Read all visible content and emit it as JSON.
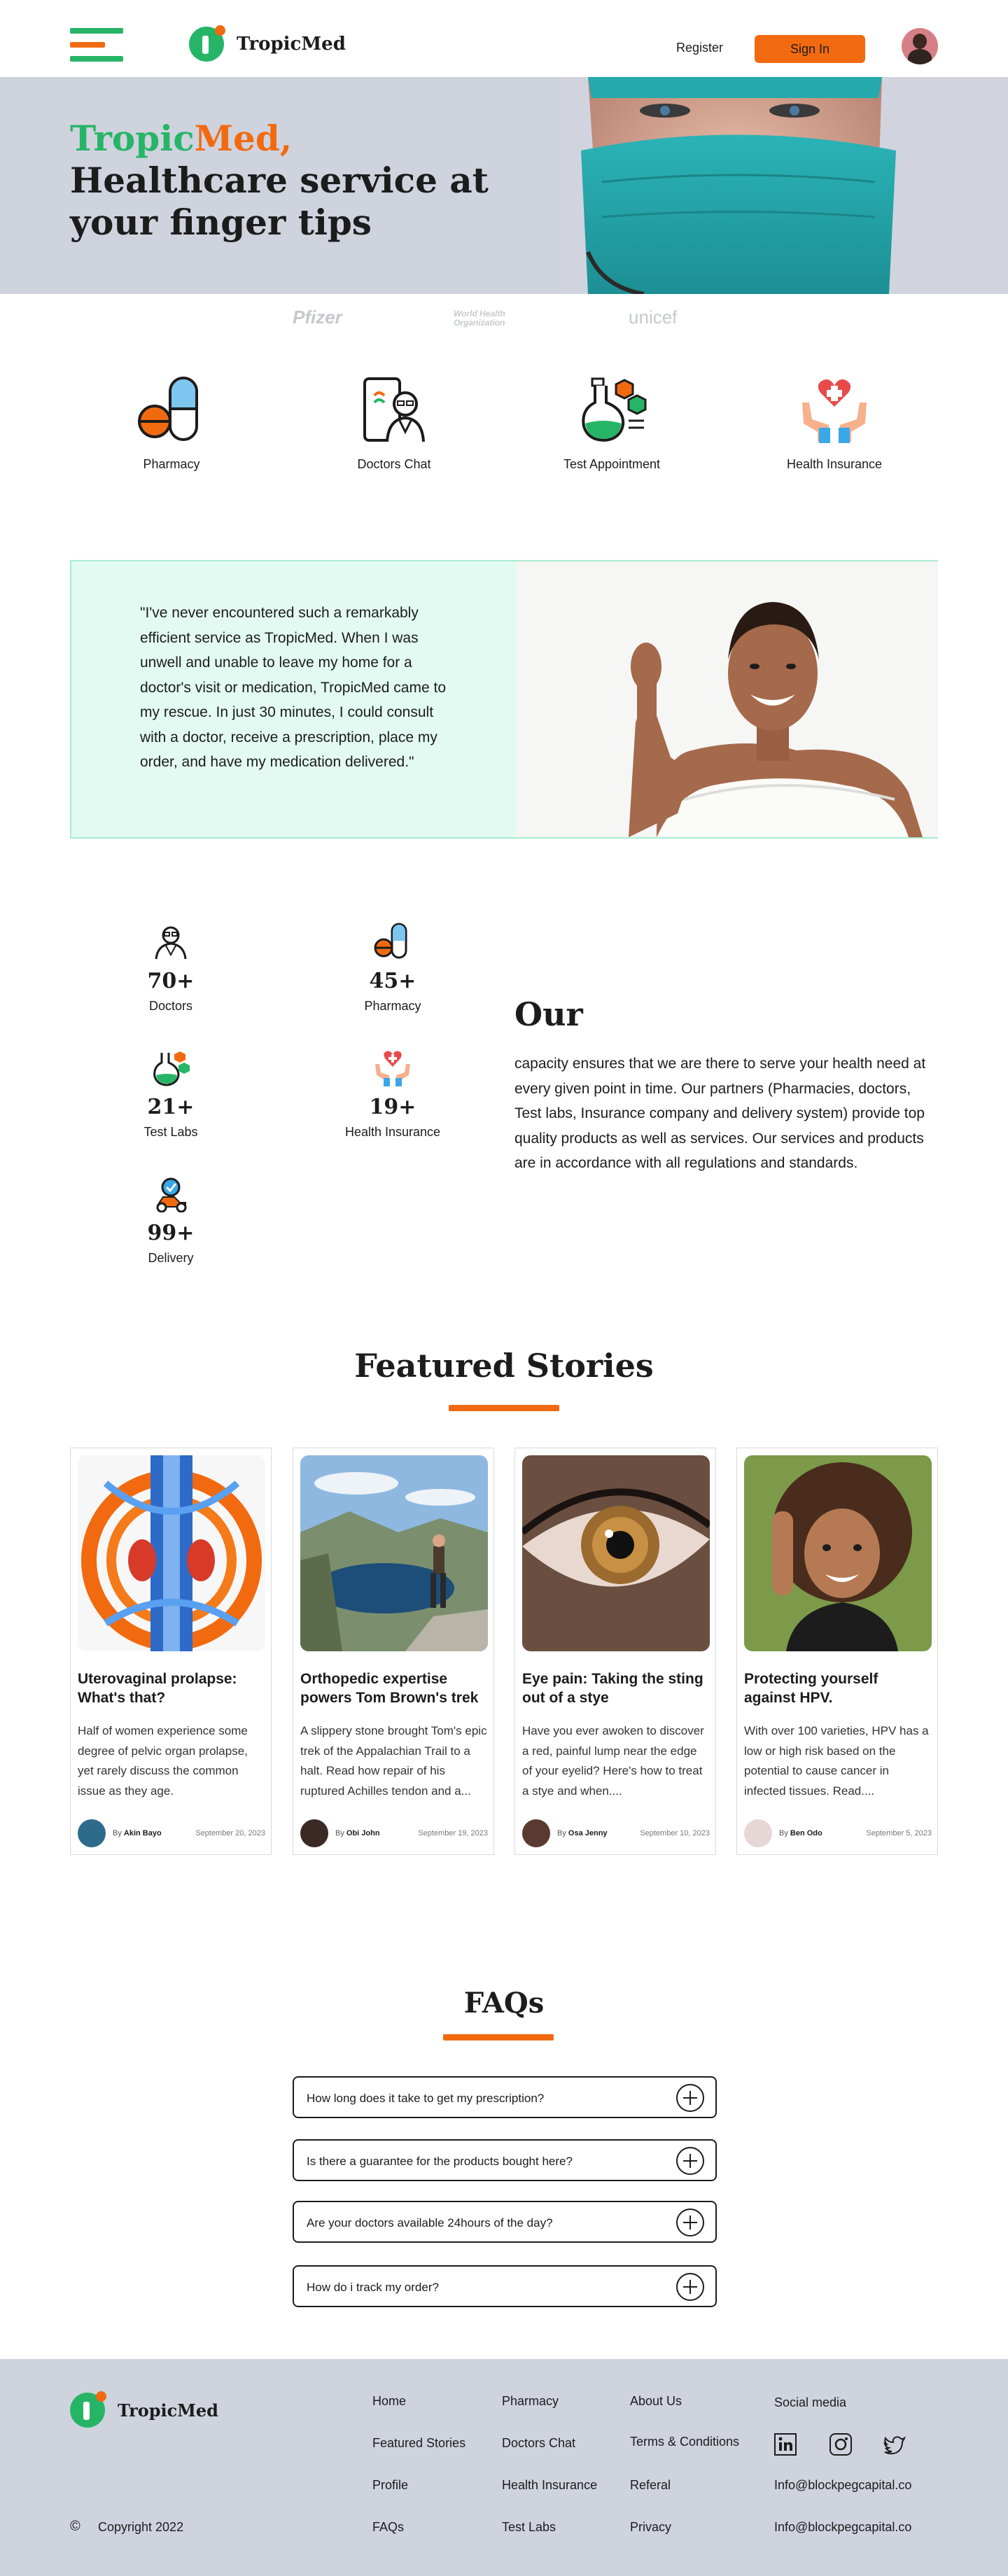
{
  "header": {
    "logo_text": "TropicMed",
    "register_label": "Register",
    "signin_label": "Sign In",
    "menu_colors": [
      "#26b567",
      "#f26a10",
      "#26b567"
    ]
  },
  "hero": {
    "title_part1": "TropicMed,",
    "title_part1a": "Tropic",
    "title_part1b": "Med,",
    "title_part2": " Healthcare service at your finger tips",
    "accent_green": "#26b567",
    "accent_orange": "#f26a10"
  },
  "partners": [
    "Pfizer",
    "World Health Organization",
    "unicef"
  ],
  "services": [
    {
      "label": "Pharmacy",
      "icon": "pill-capsule-icon"
    },
    {
      "label": "Doctors Chat",
      "icon": "doctor-phone-icon"
    },
    {
      "label": "Test Appointment",
      "icon": "lab-flask-icon"
    },
    {
      "label": "Health Insurance",
      "icon": "hands-heart-icon"
    }
  ],
  "testimonial": {
    "quote": "\"I've never encountered such a remarkably efficient service as TropicMed. When I was unwell and unable to leave my home for a doctor's visit or medication, TropicMed came to my rescue. In just 30 minutes, I could consult with a doctor, receive a prescription, place my order, and have my medication delivered.\""
  },
  "stats": [
    {
      "value": "70+",
      "label": "Doctors",
      "icon": "doctor-icon"
    },
    {
      "value": "45+",
      "label": "Pharmacy",
      "icon": "pill-capsule-icon"
    },
    {
      "value": "21+",
      "label": "Test Labs",
      "icon": "lab-flask-icon"
    },
    {
      "value": "19+",
      "label": "Health Insurance",
      "icon": "hands-heart-icon"
    },
    {
      "value": "99+",
      "label": "Delivery",
      "icon": "delivery-icon"
    }
  ],
  "our": {
    "title": "Our",
    "body": "capacity ensures that we are there to serve your health need at every given point in time. Our partners (Pharmacies, doctors, Test labs, Insurance company and delivery system) provide top quality products as well as services. Our services and products are in accordance with all regulations and standards."
  },
  "featured": {
    "title": "Featured Stories",
    "stories": [
      {
        "title": "Uterovaginal prolapse: What's that?",
        "excerpt": "Half of women experience some degree of pelvic organ prolapse, yet rarely discuss the common issue as they age.",
        "by": "By",
        "author": "Akin Bayo",
        "date": "September 20, 2023"
      },
      {
        "title": "Orthopedic expertise powers Tom Brown's trek",
        "excerpt": "A slippery stone brought Tom's epic trek of the Appalachian Trail to a halt. Read how repair of his ruptured Achilles tendon and a...",
        "by": "By",
        "author": "Obi John",
        "date": "September 19, 2023"
      },
      {
        "title": "Eye pain: Taking the sting out of a stye",
        "excerpt": "Have you ever awoken to discover a red, painful lump near the edge of your eyelid? Here's how to treat a stye and when....",
        "by": "By",
        "author": "Osa Jenny",
        "date": "September 10, 2023"
      },
      {
        "title": "Protecting yourself against HPV.",
        "excerpt": "With over 100 varieties, HPV has a low or high risk based on the potential to cause cancer in infected tissues. Read....",
        "by": "By",
        "author": "Ben Odo",
        "date": "September 5, 2023"
      }
    ]
  },
  "faqs": {
    "title": "FAQs",
    "items": [
      "How long does it take to get my prescription?",
      "Is there a guarantee for the products bought here?",
      "Are your doctors available 24hours of the day?",
      "How do i track my order?"
    ]
  },
  "footer": {
    "logo_text": "TropicMed",
    "copyright_symbol": "©",
    "copyright": "Copyright 2022",
    "col1": [
      "Home",
      "Featured Stories",
      "Profile",
      "FAQs"
    ],
    "col2": [
      "Pharmacy",
      "Doctors Chat",
      "Health Insurance",
      "Test Labs"
    ],
    "col3": [
      "About Us",
      "Terms & Conditions",
      "Referal",
      "Privacy"
    ],
    "social_title": "Social media",
    "social_icons": [
      "linkedin-icon",
      "instagram-icon",
      "twitter-icon"
    ],
    "email1": "Info@blockpegcapital.co",
    "email2": "Info@blockpegcapital.co"
  }
}
